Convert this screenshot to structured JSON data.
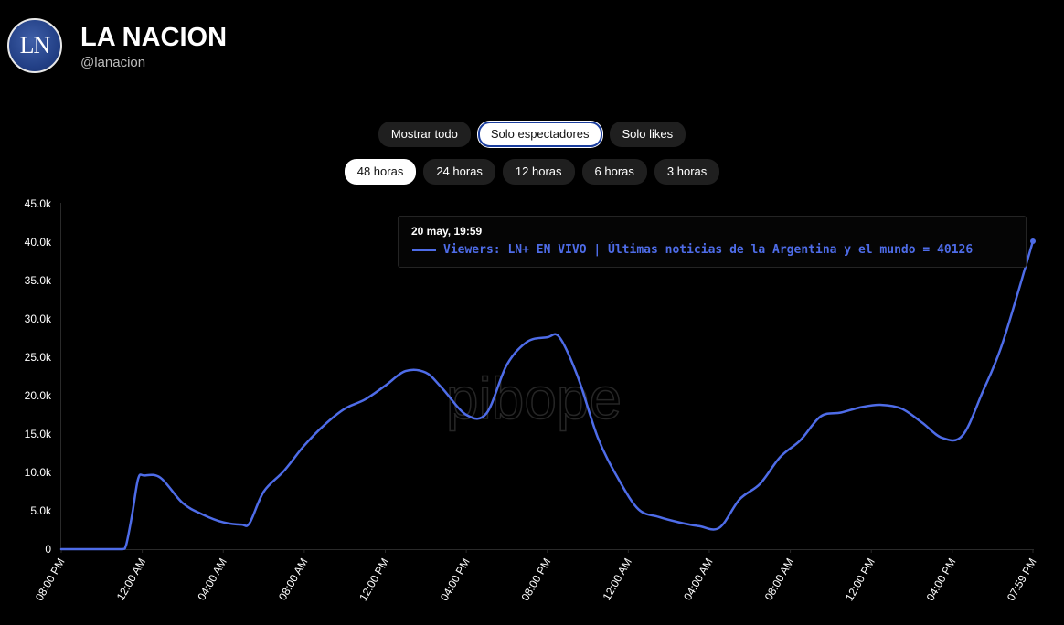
{
  "header": {
    "avatar_text": "LN",
    "title": "LA NACION",
    "handle": "@lanacion"
  },
  "filters": {
    "mode": [
      {
        "label": "Mostrar todo",
        "active": false
      },
      {
        "label": "Solo espectadores",
        "active": true
      },
      {
        "label": "Solo likes",
        "active": false
      }
    ],
    "range": [
      {
        "label": "48 horas",
        "active": true
      },
      {
        "label": "24 horas",
        "active": false
      },
      {
        "label": "12 horas",
        "active": false
      },
      {
        "label": "6 horas",
        "active": false
      },
      {
        "label": "3 horas",
        "active": false
      }
    ]
  },
  "watermark": "pibope",
  "tooltip": {
    "date": "20 may, 19:59",
    "text": "Viewers: LN+ EN VIVO | Últimas noticias de la Argentina y el mundo = 40126"
  },
  "chart_data": {
    "type": "line",
    "line_color": "#4e6ce8",
    "x_ticks": [
      "08:00 PM",
      "12:00 AM",
      "04:00 AM",
      "08:00 AM",
      "12:00 PM",
      "04:00 PM",
      "08:00 PM",
      "12:00 AM",
      "04:00 AM",
      "08:00 AM",
      "12:00 PM",
      "04:00 PM",
      "07:59 PM"
    ],
    "x_tick_hours": [
      0,
      4,
      8,
      12,
      16,
      20,
      24,
      28,
      32,
      36,
      40,
      44,
      47.98
    ],
    "y_ticks": [
      "0",
      "5.0k",
      "10.0k",
      "15.0k",
      "20.0k",
      "25.0k",
      "30.0k",
      "35.0k",
      "40.0k",
      "45.0k"
    ],
    "ylim": [
      0,
      45000
    ],
    "grid": false,
    "series": [
      {
        "name": "Viewers: LN+ EN VIVO | Últimas noticias de la Argentina y el mundo",
        "points": [
          [
            0,
            0
          ],
          [
            2,
            0
          ],
          [
            3,
            0
          ],
          [
            3.2,
            500
          ],
          [
            3.5,
            4500
          ],
          [
            3.8,
            9200
          ],
          [
            4.1,
            9600
          ],
          [
            4.9,
            9300
          ],
          [
            6,
            6000
          ],
          [
            7,
            4500
          ],
          [
            8,
            3500
          ],
          [
            8.9,
            3200
          ],
          [
            9.3,
            3400
          ],
          [
            10,
            7500
          ],
          [
            11,
            10200
          ],
          [
            12,
            13500
          ],
          [
            13,
            16200
          ],
          [
            14,
            18300
          ],
          [
            15,
            19500
          ],
          [
            16,
            21300
          ],
          [
            17,
            23200
          ],
          [
            18,
            23000
          ],
          [
            18.8,
            21000
          ],
          [
            20,
            17500
          ],
          [
            21,
            17700
          ],
          [
            22,
            24000
          ],
          [
            23,
            27000
          ],
          [
            24,
            27600
          ],
          [
            24.6,
            27600
          ],
          [
            25.5,
            22500
          ],
          [
            26.5,
            14500
          ],
          [
            27.5,
            9200
          ],
          [
            28.5,
            5200
          ],
          [
            29.5,
            4200
          ],
          [
            30.5,
            3500
          ],
          [
            31.5,
            3000
          ],
          [
            32.5,
            2800
          ],
          [
            33.5,
            6500
          ],
          [
            34.5,
            8500
          ],
          [
            35.5,
            12000
          ],
          [
            36.5,
            14200
          ],
          [
            37.5,
            17300
          ],
          [
            38.5,
            17800
          ],
          [
            39.5,
            18500
          ],
          [
            40.5,
            18800
          ],
          [
            41.5,
            18300
          ],
          [
            42.5,
            16500
          ],
          [
            43.5,
            14500
          ],
          [
            44.5,
            14800
          ],
          [
            45.5,
            20500
          ],
          [
            46.5,
            27000
          ],
          [
            47.98,
            40126
          ]
        ]
      }
    ]
  }
}
